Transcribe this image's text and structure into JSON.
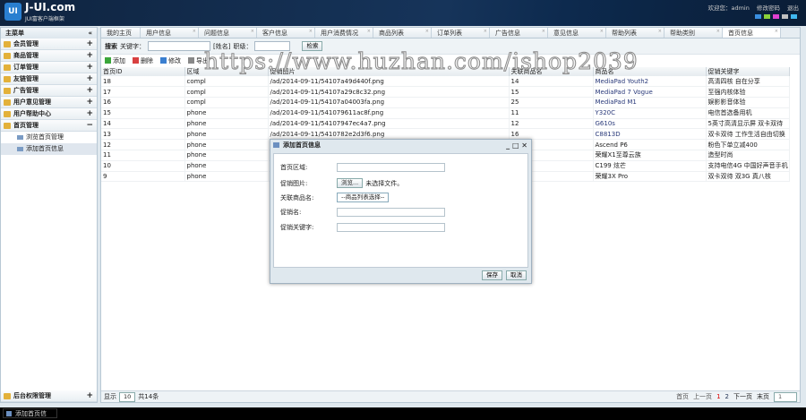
{
  "header": {
    "logo": "UI",
    "brand": "J-UI.com",
    "subtitle": "JUI富客户端框架",
    "welcome": "欢迎您：admin",
    "change_password": "修改密码",
    "logout": "退出",
    "theme_colors": [
      "#3a8fe0",
      "#8ad13a",
      "#e040d0",
      "#c0c0c0",
      "#40b8f0"
    ]
  },
  "sidebar": {
    "title": "主菜单",
    "collapse": "«",
    "items": [
      {
        "label": "会员管理",
        "toggle": "+"
      },
      {
        "label": "商品管理",
        "toggle": "+"
      },
      {
        "label": "订单管理",
        "toggle": "+"
      },
      {
        "label": "友链管理",
        "toggle": "+"
      },
      {
        "label": "广告管理",
        "toggle": "+"
      },
      {
        "label": "用户意见管理",
        "toggle": "+"
      },
      {
        "label": "用户帮助中心",
        "toggle": "+"
      },
      {
        "label": "首页管理",
        "toggle": "−"
      }
    ],
    "sub_items": [
      "浏览首页管理",
      "添加首页信息"
    ],
    "bottom_item": {
      "label": "后台权限管理",
      "toggle": "+"
    }
  },
  "tabs": [
    "我的主页",
    "用户信息",
    "问题信息",
    "客户信息",
    "用户消费情况",
    "商品列表",
    "订单列表",
    "广告信息",
    "意见信息",
    "帮助列表",
    "帮助类别",
    "首页信息"
  ],
  "search": {
    "label": "搜索",
    "keyword_label": "关键字：",
    "name_label": "[姓名]",
    "level_label": "职级：",
    "button": "检索"
  },
  "toolbar": {
    "add": "添加",
    "delete": "删除",
    "edit": "修改",
    "other": "导出"
  },
  "table": {
    "headers": [
      "首页ID",
      "区域",
      "促销图片",
      "关联商品名",
      "商品名",
      "促销关键字"
    ],
    "rows": [
      [
        "18",
        "compl",
        "/ad/2014-09-11/54107a49d440f.png",
        "14",
        "MediaPad Youth2",
        "高清四核 自在分享"
      ],
      [
        "17",
        "compl",
        "/ad/2014-09-11/54107a29c8c32.png",
        "15",
        "MediaPad 7 Vogue",
        "至强内核体验"
      ],
      [
        "16",
        "compl",
        "/ad/2014-09-11/54107a04003fa.png",
        "25",
        "MediaPad M1",
        "娱影影音体验"
      ],
      [
        "15",
        "phone",
        "/ad/2014-09-11/541079611ac8f.png",
        "11",
        "Y320C",
        "电信首选备用机"
      ],
      [
        "14",
        "phone",
        "/ad/2014-09-11/54107947ec4a7.png",
        "12",
        "G610s",
        "5英寸高清显示屏 双卡双待"
      ],
      [
        "13",
        "phone",
        "/ad/2014-09-11/5410782e2d3f6.png",
        "16",
        "C8813D",
        "双卡双待 工作生活自由切换"
      ],
      [
        "12",
        "phone",
        "",
        "",
        "Ascend P6",
        "粉色下单立减400"
      ],
      [
        "11",
        "phone",
        "",
        "",
        "荣耀X1至尊云族",
        "造型时尚"
      ],
      [
        "10",
        "phone",
        "",
        "",
        "C199 炫芒",
        "支持电信4G 中国好声音手机"
      ],
      [
        "9",
        "phone",
        "",
        "",
        "荣耀3X Pro",
        "双卡双待 双3G 真八核"
      ]
    ]
  },
  "pager": {
    "show_label": "显示",
    "page_size": "10",
    "total": "共14条",
    "first": "首页",
    "prev": "上一页",
    "pages": [
      "1",
      "2"
    ],
    "next": "下一页",
    "last": "末页",
    "goto": "1"
  },
  "dialog": {
    "title": "添加首页信息",
    "fields": [
      {
        "label": "首页区域:"
      },
      {
        "label": "促销图片:",
        "browse": "浏览...",
        "no_file": "未选择文件。"
      },
      {
        "label": "关联商品名:",
        "select": "--商品列表选择--"
      },
      {
        "label": "促销名:"
      },
      {
        "label": "促销关键字:"
      }
    ],
    "save": "保存",
    "cancel": "取消"
  },
  "taskbar": {
    "item": "添加首页信"
  },
  "watermark": "https://www.huzhan.com/ishop2039"
}
